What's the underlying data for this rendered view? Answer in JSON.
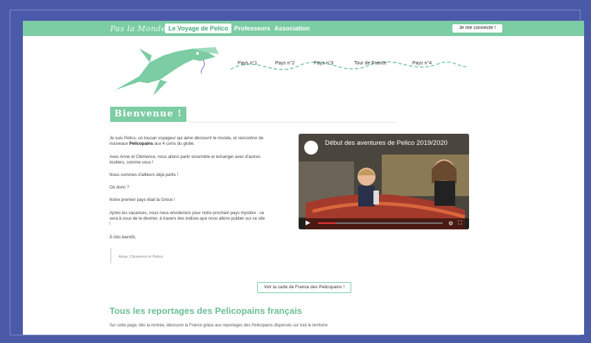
{
  "nav": {
    "brand": "Pas la Monde",
    "items": [
      {
        "label": "Le Voyage de Pelico",
        "active": true
      },
      {
        "label": "Professeurs",
        "active": false
      },
      {
        "label": "Association",
        "active": false
      }
    ],
    "login_label": "Je me connecte !"
  },
  "journey": {
    "steps": [
      "Pays n°1",
      "Pays n°2",
      "Pays n°3",
      "Tour de France",
      "Pays n°4"
    ]
  },
  "welcome": {
    "title": "Bienvenue !",
    "paragraphs": [
      "Je suis Pelico, un toucan voyageur qui aime découvrir le monde, et rencontrer de nouveaux",
      "Avec Anne et Clémence, nous allons partir ensemble et échanger avec d'autres écoliers, comme vous !",
      "Nous sommes d'ailleurs déjà partis !",
      "Où donc ?",
      "Notre premier pays était la Grèce !",
      "Après les vacances, nous nous envolerons pour notre prochain pays mystère : ce sera à vous de le deviner, à travers des indices que nous allons publier sur ce site !",
      "À très bientôt,"
    ],
    "highlight": "Pelicopains",
    "after_highlight": "aux 4 coins du globe.",
    "signature": "Anne, Clémence et Pelico"
  },
  "video": {
    "title": "Début des aventures de Pelico 2019/2020"
  },
  "map_button_label": "Voir la carte de France des Pelicopains !",
  "reports": {
    "heading": "Tous les reportages des Pelicopains français",
    "text": "Sur cette page, dès la rentrée, découvre la France grâce aux reportages des Pelicopains dispersés sur tout le territoire"
  },
  "colors": {
    "accent": "#7ccca4",
    "frame": "#4b5aa8"
  }
}
